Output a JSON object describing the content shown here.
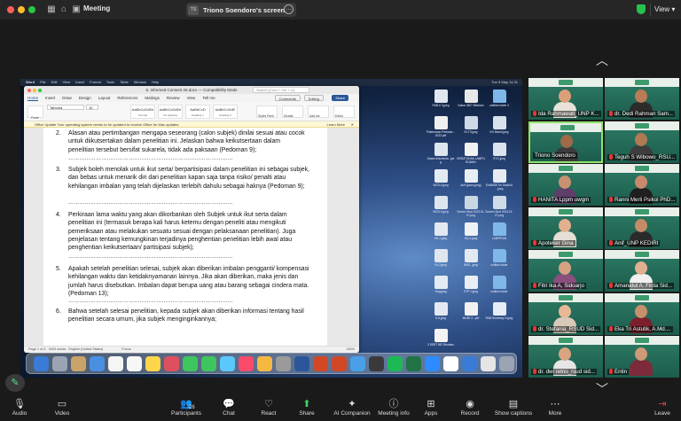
{
  "topbar": {
    "meeting_title": "Meeting",
    "share_badge": "TS",
    "share_label": "Triono Soendoro's screen",
    "view_label": "View"
  },
  "word": {
    "title": "6. Informed Consent 26.docx — Compatibility Mode",
    "search_placeholder": "Search (Cmd + Ctrl + U)",
    "tabs": [
      "Home",
      "Insert",
      "Draw",
      "Design",
      "Layout",
      "References",
      "Mailings",
      "Review",
      "View",
      "Tell me"
    ],
    "active_tab": "Home",
    "comments_label": "Comments",
    "editing_label": "Editing",
    "share_label": "Share",
    "font_name": "Tahoma",
    "font_size": "10",
    "paste_label": "Paste",
    "styles": [
      {
        "sample": "AaBbCcDdEe",
        "name": "Normal"
      },
      {
        "sample": "AaBbCcDdEe",
        "name": "No Spacing"
      },
      {
        "sample": "AaBbCcD",
        "name": "Heading 1"
      },
      {
        "sample": "AaBbCcDdE",
        "name": "Heading 2"
      }
    ],
    "right_tools": [
      "Styles Pane",
      "Dictate",
      "Add-ins",
      "Editor"
    ],
    "update_text": "Office Update   Your operating system needs to be updated to receive Office for Mac updates.",
    "learn_more": "Learn More",
    "paragraphs": [
      {
        "num": "2.",
        "text": "Alasan atau pertimbangan mengapa seseorang (calon subjek) dinilai sesuai atau cocok untuk diikutsertakan dalam penelitian ini. Jelaskan bahwa keikutsertaan dalam penelitian tersebut bersifat sukarela, tidak ada paksaan (Pedoman 9);"
      },
      {
        "num": "3.",
        "text": "Subjek boleh menolak untuk ikut serta/ berpartisipasi dalam penelitian ini sebagai subjek,  dan bebas untuk menarik diri dari penelitian kapan saja tanpa risiko/ penalti atau kehilangan imbalan yang telah dijelaskan terlebih dahulu sebagai haknya (Pedoman 9);"
      },
      {
        "num": "4.",
        "text": "Perkiraan lama waktu yang akan dikorbankan oleh Subjek untuk ikut serta dalam penelitian ini (termasuk berapa kali harus ketemu dengan peneliti atau mengikuti pemeriksaan atau melakukan sesuatu sesuai dengan pelaksanaan penelitian). Juga penjelasan tentang kemungkinan terjadinya penghentian penelitian lebih awal atau penghentian keikutsertaan/ partisipasi subjek);"
      },
      {
        "num": "5.",
        "text": "Apakah setelah penelitian selesai, subjek akan diberikan imbalan pengganti/ kompensasi kehilangan waktu dan ketidaknyamanan lainnya. Jika akan diberikan, maka jenis dan jumlah harus disebutkan. Imbalan dapat berupa uang  atau barang sebagai cindera mata. (Pedoman 13);"
      },
      {
        "num": "6.",
        "text": "Bahwa setelah selesai penelitian, kepada subjek akan diberikan informasi tentang hasil penelitian secara umum, jika subjek menginginkannya;"
      }
    ],
    "dots": "………………………………………………………………………………",
    "status_page": "Page 1 of 5",
    "status_words": "3434 words",
    "status_lang": "English (United States)",
    "status_focus": "Focus",
    "status_zoom": "130%"
  },
  "mac": {
    "menu": [
      "Word",
      "File",
      "Edit",
      "View",
      "Insert",
      "Format",
      "Tools",
      "Table",
      "Window",
      "Help"
    ],
    "clock": "Tue 5 May  14.31"
  },
  "desktop_icons": [
    {
      "label": "RAB-6 3.jpeg",
      "color": "#dfe7f0"
    },
    {
      "label": "Kabar 4827 Bimbam",
      "color": "#e8e8e8"
    },
    {
      "label": "untitled folder 3",
      "color": "#7fb7e8"
    },
    {
      "label": "Pakemaran Perbaha...2022.pdf",
      "color": "#f0f0f0"
    },
    {
      "label": "IN-T9.jpeg",
      "color": "#cdd9e5"
    },
    {
      "label": "KH Blokdi.jpeg",
      "color": "#d8e2ec"
    },
    {
      "label": "Gases Indonesia...jpeg",
      "color": "#e0e6ee"
    },
    {
      "label": "KEBUTUHAN LAMPU RUMAH",
      "color": "#f2f2f2"
    },
    {
      "label": "SYG.jpeg",
      "color": "#dbe4ee"
    },
    {
      "label": "WCD-6.jpeg",
      "color": "#e4eaf1"
    },
    {
      "label": "AuN (jaaru.jpeg)",
      "color": "#e9eef4"
    },
    {
      "label": "EuNMSE Sn Shulki.6 ...jpeg",
      "color": "#e6ebf2"
    },
    {
      "label": "WCD-5.jpeg",
      "color": "#dde5ee"
    },
    {
      "label": "Screen Shot 2023-01-07.png",
      "color": "#c9d6e3"
    },
    {
      "label": "Screen Shot 2023-01-07.png",
      "color": "#cfdbe7"
    },
    {
      "label": "KH-1.jpeg",
      "color": "#e1e8f0"
    },
    {
      "label": "HQ-4.jpeg",
      "color": "#eef2f6"
    },
    {
      "label": "LAMPIRAN",
      "color": "#7fb7e8"
    },
    {
      "label": "Fy-3.jpeg",
      "color": "#dfe6ee"
    },
    {
      "label": "BNG...jpeg",
      "color": "#e3e9f0"
    },
    {
      "label": "untitled folder",
      "color": "#7fb7e8"
    },
    {
      "label": "Ying.jpeg",
      "color": "#e5ebf2"
    },
    {
      "label": "KTP 1.jpeg",
      "color": "#eaeef4"
    },
    {
      "label": "untitled folder",
      "color": "#7fb7e8"
    },
    {
      "label": "K-6.jpeg",
      "color": "#e2e9f0"
    },
    {
      "label": "MLBE 2...pdf",
      "color": "#f1f1f1"
    },
    {
      "label": "RAB Summary 3.jpeg",
      "color": "#e6ecf3"
    },
    {
      "label": "3 SERT 867 Bimbam",
      "color": "#f3f3f3"
    }
  ],
  "dock_colors": [
    "#3a7bd5",
    "#9aa4b2",
    "#c9a46a",
    "#4a90e2",
    "#f5f5f5",
    "#f7f7f7",
    "#ffd54a",
    "#e04f5f",
    "#3fc55e",
    "#3fc55e",
    "#5ac8fa",
    "#fa4b6a",
    "#f5b942",
    "#9a9a9a",
    "#2b579a",
    "#d24726",
    "#d24726",
    "#4aa0e6",
    "#3a3a3a",
    "#1db954",
    "#217346",
    "#2d8cff",
    "#ffffff",
    "#3a7bd5",
    "#e5e5e5",
    "#9aa4b2"
  ],
  "participants": [
    {
      "name": "Ida Rahmawati_UNP K...",
      "muted": true,
      "skin": "#d9a07a",
      "shirt": "#e9e2d8",
      "active": false
    },
    {
      "name": "dr. Dedi Rahman Sam...",
      "muted": true,
      "skin": "#b87c56",
      "shirt": "#2c2c2c",
      "active": false
    },
    {
      "name": "Triono Soendoro",
      "muted": false,
      "skin": "#a06a48",
      "shirt": "#3b3b3b",
      "active": true
    },
    {
      "name": "Teguh S Wibowo_RSU...",
      "muted": true,
      "skin": "#b07a55",
      "shirt": "#3d3d3d",
      "active": false
    },
    {
      "name": "HANITA Lppm uwgm",
      "muted": true,
      "skin": "#c89272",
      "shirt": "#5d3f6a",
      "active": false
    },
    {
      "name": "Ranni Merli Psikol PhD...",
      "muted": true,
      "skin": "#c88a6a",
      "shirt": "#1f1f1f",
      "active": false
    },
    {
      "name": "Apoteker Gina",
      "muted": true,
      "skin": "#e3b08e",
      "shirt": "#e5e0d5",
      "active": false
    },
    {
      "name": "Anif_UNP KEDIRI",
      "muted": true,
      "skin": "#c48b66",
      "shirt": "#2b2b2b",
      "active": false
    },
    {
      "name": "Fitri Ika A, Sidoarjo",
      "muted": true,
      "skin": "#d7a283",
      "shirt": "#8a4f7d",
      "active": false
    },
    {
      "name": "Amanatul A. Firda Sid...",
      "muted": true,
      "skin": "#e0b090",
      "shirt": "#f0f0f0",
      "active": false
    },
    {
      "name": "dr. Stefania_RSUD Sid...",
      "muted": true,
      "skin": "#e6b896",
      "shirt": "#d9c9b8",
      "active": false
    },
    {
      "name": "Eka Tri Astutik, A.Md....",
      "muted": true,
      "skin": "#c7906c",
      "shirt": "#7a1f2b",
      "active": false
    },
    {
      "name": "dr. dwi retno_rsud sid...",
      "muted": true,
      "skin": "#d9a581",
      "shirt": "#e6e6e6",
      "active": false
    },
    {
      "name": "Entin",
      "muted": true,
      "skin": "#cf9a77",
      "shirt": "#7d2b3b",
      "active": false
    }
  ],
  "toolbar": {
    "audio": "Audio",
    "video": "Video",
    "participants": "Participants",
    "participants_count": "26",
    "chat": "Chat",
    "react": "React",
    "share": "Share",
    "ai_companion": "AI Companion",
    "meeting_info": "Meeting info",
    "apps": "Apps",
    "record": "Record",
    "show_captions": "Show captions",
    "more": "More",
    "leave": "Leave"
  }
}
